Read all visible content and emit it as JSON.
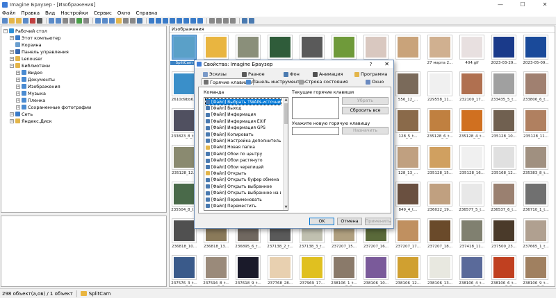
{
  "window": {
    "title": "Imagine Браузер - [Изображения]",
    "controls": [
      "—",
      "☐",
      "✕"
    ]
  },
  "menu": [
    "Файл",
    "Правка",
    "Вид",
    "Настройки",
    "Сервис",
    "Окно",
    "Справка"
  ],
  "tree": [
    {
      "label": "Рабочий стол",
      "exp": "−",
      "depth": 0,
      "color": "#2c8fd6"
    },
    {
      "label": "Этот компьютер",
      "exp": "+",
      "depth": 1,
      "color": "#3a7bc8"
    },
    {
      "label": "Корзина",
      "exp": "",
      "depth": 1,
      "color": "#6b9fcf"
    },
    {
      "label": "Панель управления",
      "exp": "+",
      "depth": 1,
      "color": "#3a6ab0"
    },
    {
      "label": "Lenouser",
      "exp": "+",
      "depth": 1,
      "color": "#e3b54a"
    },
    {
      "label": "Библиотеки",
      "exp": "−",
      "depth": 1,
      "color": "#e3b54a"
    },
    {
      "label": "Видео",
      "exp": "+",
      "depth": 2,
      "color": "#4a8bd1"
    },
    {
      "label": "Документы",
      "exp": "+",
      "depth": 2,
      "color": "#4a8bd1"
    },
    {
      "label": "Изображения",
      "exp": "+",
      "depth": 2,
      "color": "#4a8bd1"
    },
    {
      "label": "Музыка",
      "exp": "+",
      "depth": 2,
      "color": "#4a8bd1"
    },
    {
      "label": "Пленка",
      "exp": "+",
      "depth": 2,
      "color": "#4a8bd1"
    },
    {
      "label": "Сохраненные фотографии",
      "exp": "+",
      "depth": 2,
      "color": "#4a8bd1"
    },
    {
      "label": "Сеть",
      "exp": "+",
      "depth": 1,
      "color": "#3a7bc8"
    },
    {
      "label": "Яндекс.Диск",
      "exp": "+",
      "depth": 1,
      "color": "#e3b54a"
    }
  ],
  "thumbs": {
    "header": "Изображения",
    "rows": [
      [
        {
          "l": "SplitCam",
          "c": "#5aa0c8"
        },
        {
          "l": "",
          "c": "#e9b540"
        },
        {
          "l": "",
          "c": "#8a8f7a"
        },
        {
          "l": "",
          "c": "#2f5c3a"
        },
        {
          "l": "",
          "c": "#5a5a5a"
        },
        {
          "l": "",
          "c": "#6f9a3a"
        },
        {
          "l": "",
          "c": "#d9c8c0"
        },
        {
          "l": "",
          "c": "#c9a37a"
        },
        {
          "l": "27 марта 2...",
          "c": "#d0b090"
        },
        {
          "l": "404.gif",
          "c": "#e8e0e0"
        },
        {
          "l": "2023-03-29...",
          "c": "#1a3a8a"
        },
        {
          "l": "2023-05-09...",
          "c": "#1a4a9a"
        }
      ],
      [
        {
          "l": "2610d9bb6...",
          "c": "#3a8fc9"
        },
        {
          "l": "",
          "c": "#888"
        },
        {
          "l": "",
          "c": "#888"
        },
        {
          "l": "",
          "c": "#888"
        },
        {
          "l": "",
          "c": "#888"
        },
        {
          "l": "",
          "c": "#888"
        },
        {
          "l": "",
          "c": "#888"
        },
        {
          "l": "556_12_...",
          "c": "#7a6a5a"
        },
        {
          "l": "229558_11...",
          "c": "#f0f0f0"
        },
        {
          "l": "232100_17...",
          "c": "#b07050"
        },
        {
          "l": "233435_5_t...",
          "c": "#a0a0a0"
        },
        {
          "l": "233806_6_t...",
          "c": "#a08070"
        }
      ],
      [
        {
          "l": "233823_8_t...",
          "c": "#505060"
        },
        {
          "l": "",
          "c": "#888"
        },
        {
          "l": "",
          "c": "#888"
        },
        {
          "l": "",
          "c": "#888"
        },
        {
          "l": "",
          "c": "#888"
        },
        {
          "l": "",
          "c": "#888"
        },
        {
          "l": "",
          "c": "#888"
        },
        {
          "l": "128_5_t...",
          "c": "#8a6a4a"
        },
        {
          "l": "235128_6_t...",
          "c": "#c08040"
        },
        {
          "l": "235128_4_t...",
          "c": "#d07020"
        },
        {
          "l": "235128_10...",
          "c": "#706050"
        },
        {
          "l": "235128_11...",
          "c": "#b08060"
        }
      ],
      [
        {
          "l": "235128_12...",
          "c": "#8a8a70"
        },
        {
          "l": "",
          "c": "#888"
        },
        {
          "l": "",
          "c": "#888"
        },
        {
          "l": "",
          "c": "#888"
        },
        {
          "l": "",
          "c": "#888"
        },
        {
          "l": "",
          "c": "#888"
        },
        {
          "l": "",
          "c": "#888"
        },
        {
          "l": "128_13_...",
          "c": "#c0a080"
        },
        {
          "l": "235128_15...",
          "c": "#d0a060"
        },
        {
          "l": "235128_16...",
          "c": "#f0f0f0"
        },
        {
          "l": "235168_12...",
          "c": "#e0e0e0"
        },
        {
          "l": "235383_8_t...",
          "c": "#a09080"
        }
      ],
      [
        {
          "l": "235504_8_t...",
          "c": "#4a6a4a"
        },
        {
          "l": "",
          "c": "#888"
        },
        {
          "l": "",
          "c": "#888"
        },
        {
          "l": "",
          "c": "#888"
        },
        {
          "l": "",
          "c": "#888"
        },
        {
          "l": "",
          "c": "#888"
        },
        {
          "l": "",
          "c": "#888"
        },
        {
          "l": "849_4_t...",
          "c": "#6a5040"
        },
        {
          "l": "236022_19...",
          "c": "#c0a080"
        },
        {
          "l": "236577_5_t...",
          "c": "#e8e8e8"
        },
        {
          "l": "236537_6_t...",
          "c": "#9a8070"
        },
        {
          "l": "236710_1_t...",
          "c": "#707070"
        }
      ],
      [
        {
          "l": "236818_10...",
          "c": "#505050"
        },
        {
          "l": "236818_13...",
          "c": "#8a7a5a"
        },
        {
          "l": "236895_6_t...",
          "c": "#706860"
        },
        {
          "l": "237138_2_t...",
          "c": "#5a5a5a"
        },
        {
          "l": "237138_3_t...",
          "c": "#c0c0b0"
        },
        {
          "l": "237207_15...",
          "c": "#b0a080"
        },
        {
          "l": "237207_16...",
          "c": "#5a6a3a"
        },
        {
          "l": "237207_17...",
          "c": "#c09060"
        },
        {
          "l": "237207_18...",
          "c": "#6a4a2a"
        },
        {
          "l": "237418_11...",
          "c": "#808070"
        },
        {
          "l": "237500_23...",
          "c": "#4a3a2a"
        },
        {
          "l": "237665_1_t...",
          "c": "#b0a090"
        }
      ],
      [
        {
          "l": "237576_3_t...",
          "c": "#3a5a8a"
        },
        {
          "l": "237594_8_t...",
          "c": "#9a8a7a"
        },
        {
          "l": "237618_9_t...",
          "c": "#1a1a2a"
        },
        {
          "l": "237768_28...",
          "c": "#e8d0b0"
        },
        {
          "l": "237969_17...",
          "c": "#e0c020"
        },
        {
          "l": "238106_1_t...",
          "c": "#8a7a6a"
        },
        {
          "l": "238106_10...",
          "c": "#7a5a9a"
        },
        {
          "l": "238106_12...",
          "c": "#d0a030"
        },
        {
          "l": "238106_13...",
          "c": "#e8e8e0"
        },
        {
          "l": "238106_4_t...",
          "c": "#5a6a9a"
        },
        {
          "l": "238106_6_t...",
          "c": "#c04020"
        },
        {
          "l": "238106_9_t...",
          "c": "#a08060"
        }
      ]
    ]
  },
  "status": {
    "count": "298 объект(а,ов) / 1 объект",
    "folder": "SplitCam"
  },
  "dialog": {
    "title": "Свойства: Imagine Браузер",
    "help": "?",
    "close": "✕",
    "tabs_row1": [
      {
        "label": "Эскизы",
        "color": "#7a9ac8"
      },
      {
        "label": "Разное",
        "color": "#5a5a5a"
      },
      {
        "label": "Фон",
        "color": "#4a7ab0"
      },
      {
        "label": "Анимация",
        "color": "#505050"
      },
      {
        "label": "Программа",
        "color": "#e3b54a"
      }
    ],
    "tabs_row2": [
      {
        "label": "Горячие клавиши",
        "color": "#707070"
      },
      {
        "label": "Панель инструментов",
        "color": "#4a8ad0"
      },
      {
        "label": "Строка состояния",
        "color": "#a0a0a0"
      },
      {
        "label": "Окно",
        "color": "#6a8ac0"
      }
    ],
    "command_label": "Команда",
    "current_keys_label": "Текущие горячие клавиши",
    "new_key_label": "Укажите новую горячую клавишу",
    "remove_btn": "Убрать",
    "reset_all_btn": "Сбросить все",
    "assign_btn": "Назначить",
    "ok_btn": "OK",
    "cancel_btn": "Отмена",
    "apply_btn": "Применить",
    "commands": [
      {
        "label": "[Файл] Выбрать TWAIN-источник",
        "color": "#4a7ab0"
      },
      {
        "label": "[Файл] Выход",
        "color": "#4a7ab0"
      },
      {
        "label": "[Файл] Информация",
        "color": "#4a7ab0"
      },
      {
        "label": "[Файл] Информация EXIF",
        "color": "#4a7ab0"
      },
      {
        "label": "[Файл] Информация GPS",
        "color": "#4a7ab0"
      },
      {
        "label": "[Файл] Копировать",
        "color": "#4a7ab0"
      },
      {
        "label": "[Файл] Настройка дополнительных прог",
        "color": "#4a7ab0"
      },
      {
        "label": "[Файл] Новая папка",
        "color": "#e3b54a"
      },
      {
        "label": "[Файл] Обои по центру",
        "color": "#4a7ab0"
      },
      {
        "label": "[Файл] Обои растянуто",
        "color": "#4a7ab0"
      },
      {
        "label": "[Файл] Обои черепицей",
        "color": "#4a7ab0"
      },
      {
        "label": "[Файл] Открыть",
        "color": "#e3b54a"
      },
      {
        "label": "[Файл] Открыть буфер обмена",
        "color": "#4a7ab0"
      },
      {
        "label": "[Файл] Открыть выбранное",
        "color": "#4a7ab0"
      },
      {
        "label": "[Файл] Открыть выбранное на весь экр",
        "color": "#4a7ab0"
      },
      {
        "label": "[Файл] Переименовать",
        "color": "#4a7ab0"
      },
      {
        "label": "[Файл] Переместить",
        "color": "#4a7ab0"
      }
    ]
  }
}
